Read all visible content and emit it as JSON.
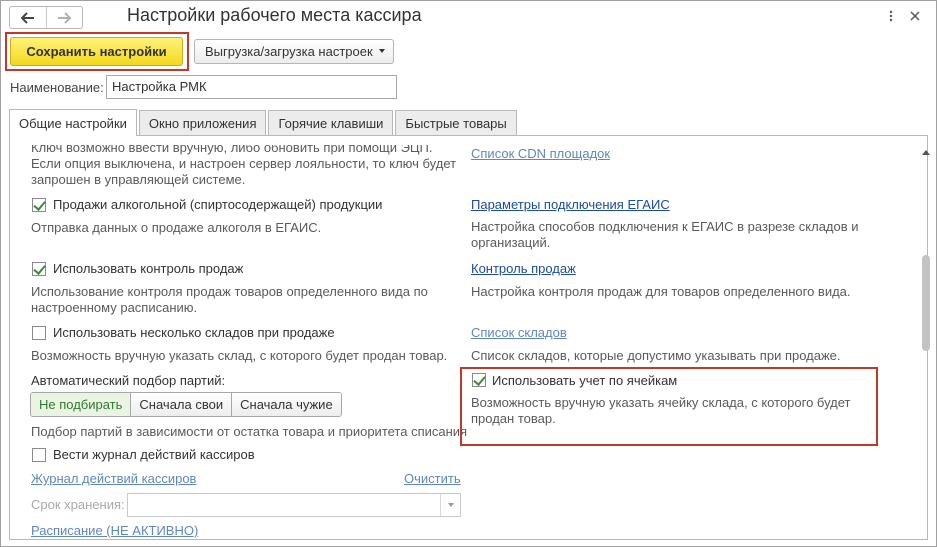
{
  "window": {
    "title": "Настройки рабочего места кассира"
  },
  "toolbar": {
    "save_label": "Сохранить настройки",
    "export_label": "Выгрузка/загрузка настроек"
  },
  "name_field": {
    "label": "Наименование:",
    "value": "Настройка РМК"
  },
  "tabs": [
    {
      "label": "Общие настройки",
      "active": true
    },
    {
      "label": "Окно приложения",
      "active": false
    },
    {
      "label": "Горячие клавиши",
      "active": false
    },
    {
      "label": "Быстрые товары",
      "active": false
    }
  ],
  "left": {
    "key_text": [
      "Ключ возможно ввести вручную, либо обновить при помощи ЭЦП.",
      "Если опция выключена, и настроен сервер лояльности, то ключ будет",
      "запрошен в управляющей системе."
    ],
    "alcohol": {
      "label": "Продажи алкогольной (спиртосодержащей) продукции",
      "checked": true,
      "desc": "Отправка данных о продаже алкоголя в ЕГАИС."
    },
    "sales_control": {
      "label": "Использовать контроль продаж",
      "checked": true,
      "desc": [
        "Использование контроля продаж товаров определенного вида по",
        "настроенному расписанию."
      ]
    },
    "multi_warehouse": {
      "label": "Использовать несколько складов при продаже",
      "checked": false,
      "desc": "Возможность вручную указать склад, с которого будет продан товар."
    },
    "batch": {
      "label": "Автоматический подбор партий:",
      "options": [
        "Не подбирать",
        "Сначала свои",
        "Сначала чужие"
      ],
      "selected": 0,
      "desc": "Подбор партий в зависимости от остатка товара и приоритета списания"
    },
    "journal": {
      "label": "Вести журнал действий кассиров",
      "checked": false,
      "link": "Журнал действий кассиров",
      "clear": "Очистить",
      "storage_label": "Срок хранения:",
      "schedule_link": "Расписание (НЕ АКТИВНО)"
    }
  },
  "right": {
    "cdn_link": "Список CDN площадок",
    "egais_link": "Параметры подключения ЕГАИС",
    "egais_desc": [
      "Настройка способов подключения к ЕГАИС в разрезе складов и",
      "организаций."
    ],
    "sales_control_link": "Контроль продаж",
    "sales_control_desc": "Настройка контроля продаж для товаров определенного вида.",
    "warehouses_link": "Список складов",
    "warehouses_desc": "Список складов, которые допустимо указывать при продаже.",
    "cells": {
      "label": "Использовать учет по ячейкам",
      "checked": true,
      "desc": [
        "Возможность вручную указать ячейку склада, с которого будет",
        "продан товар."
      ]
    }
  },
  "colors": {
    "save_button": "#f5dd2a",
    "highlight_border": "#c0392b",
    "link": "#2a5ca8",
    "selected_option": "#2f7a2f"
  }
}
